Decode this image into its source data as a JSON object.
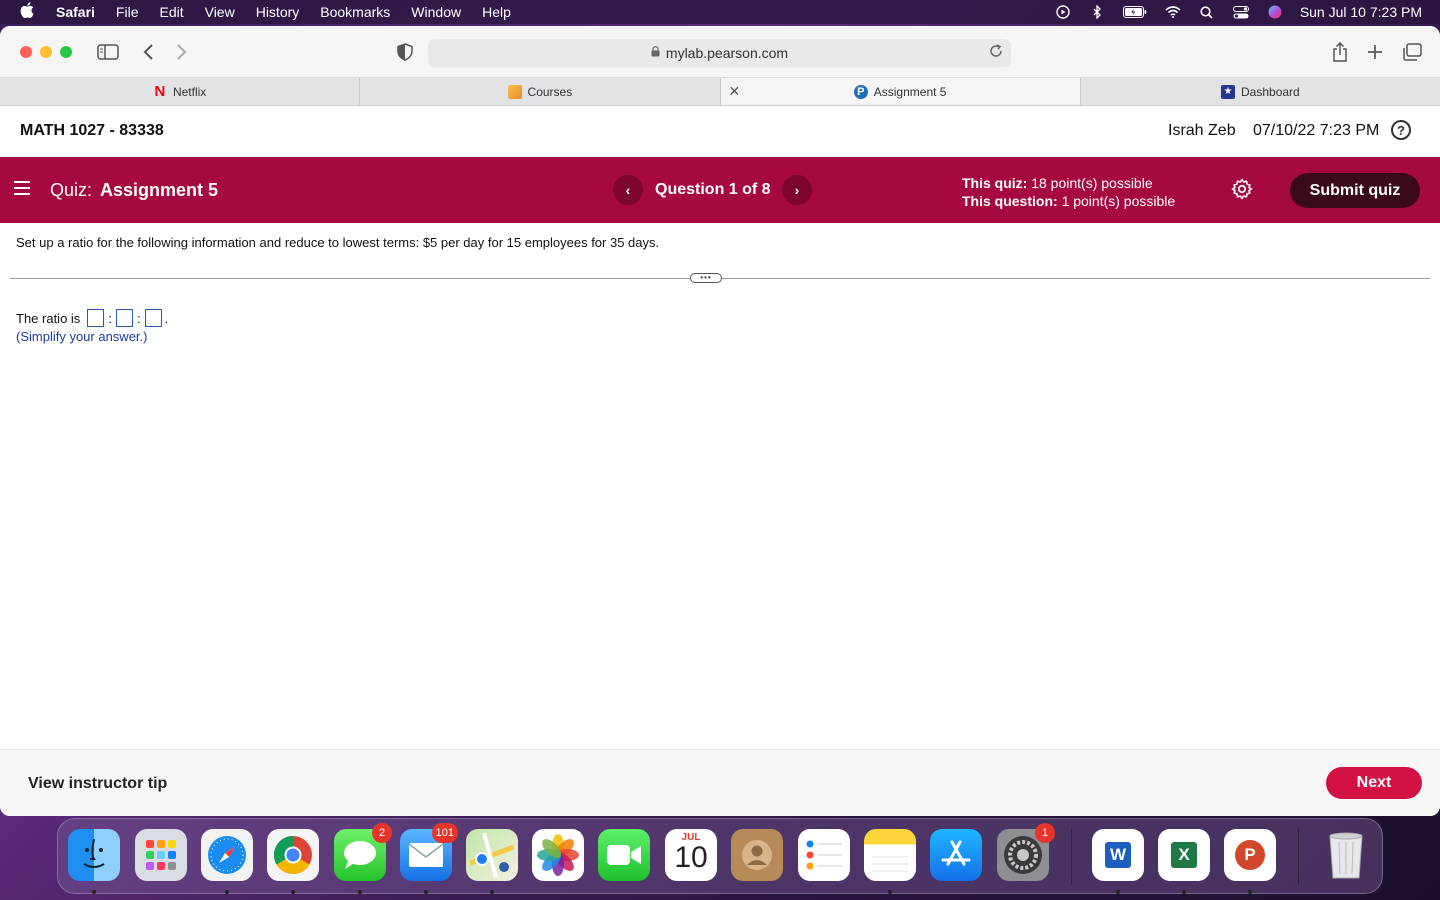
{
  "menubar": {
    "app": "Safari",
    "items": [
      "File",
      "Edit",
      "View",
      "History",
      "Bookmarks",
      "Window",
      "Help"
    ],
    "datetime": "Sun Jul 10  7:23 PM"
  },
  "browser": {
    "url": "mylab.pearson.com",
    "tabs": [
      {
        "label": "Netflix",
        "icon": "netflix-icon",
        "color": "#e50914"
      },
      {
        "label": "Courses",
        "icon": "courses-icon",
        "color": "#f3a733"
      },
      {
        "label": "Assignment 5",
        "icon": "pearson-icon",
        "color": "#1f6fb6"
      },
      {
        "label": "Dashboard",
        "icon": "dashboard-icon",
        "color": "#26358c"
      }
    ]
  },
  "course": {
    "title": "MATH 1027 - 83338",
    "user": "Israh Zeb",
    "datetime": "07/10/22 7:23 PM"
  },
  "quiz": {
    "label": "Quiz:",
    "name": "Assignment 5",
    "question_count": "Question 1 of 8",
    "quiz_points_label": "This quiz:",
    "quiz_points": "18 point(s) possible",
    "question_points_label": "This question:",
    "question_points": "1 point(s) possible",
    "submit_label": "Submit quiz",
    "accent_color": "#a5093f"
  },
  "question": {
    "text": "Set up a ratio for the following information and reduce to lowest terms: $5 per day for 15 employees for 35 days.",
    "answer_prefix": "The ratio is",
    "separator": ":",
    "hint": "(Simplify your answer.)",
    "answers": [
      "",
      "",
      ""
    ]
  },
  "footer": {
    "tip_label": "View instructor tip",
    "next_label": "Next"
  },
  "dock": {
    "calendar_month": "JUL",
    "calendar_day": "10",
    "messages_badge": "2",
    "mail_badge": "101",
    "settings_badge": "1",
    "word_letter": "W",
    "excel_letter": "X",
    "powerpoint_letter": "P"
  }
}
